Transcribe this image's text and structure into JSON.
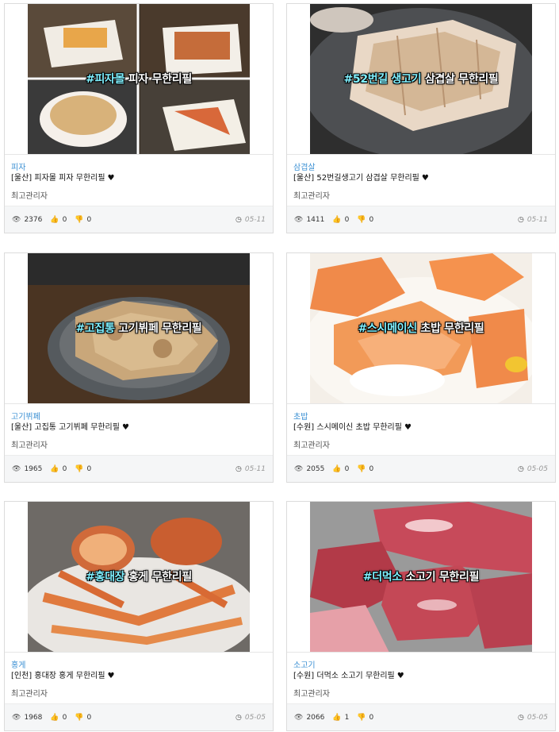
{
  "cards": [
    {
      "category": "피자",
      "title": "[울산] 피자몰 피자 무한리필",
      "author": "최고관리자",
      "views": "2376",
      "likes": "0",
      "dislikes": "0",
      "date": "05-11",
      "caption_tag": "#피자몰",
      "caption_text": " 피자 무한리필"
    },
    {
      "category": "삼겹살",
      "title": "[울산] 52번길생고기 삼겹살 무한리필",
      "author": "최고관리자",
      "views": "1411",
      "likes": "0",
      "dislikes": "0",
      "date": "05-11",
      "caption_tag": "#52번길 생고기",
      "caption_text": " 삼겹살 무한리필"
    },
    {
      "category": "고기뷔페",
      "title": "[울산] 고집통 고기뷔페 무한리필",
      "author": "최고관리자",
      "views": "1965",
      "likes": "0",
      "dislikes": "0",
      "date": "05-11",
      "caption_tag": "#고집통",
      "caption_text": " 고기뷔페 무한리필"
    },
    {
      "category": "초밥",
      "title": "[수원] 스시메이신 초밥 무한리필",
      "author": "최고관리자",
      "views": "2055",
      "likes": "0",
      "dislikes": "0",
      "date": "05-05",
      "caption_tag": "#스시메이신",
      "caption_text": " 초밥 무한리필"
    },
    {
      "category": "홍게",
      "title": "[인천] 홍대장 홍게 무한리필",
      "author": "최고관리자",
      "views": "1968",
      "likes": "0",
      "dislikes": "0",
      "date": "05-05",
      "caption_tag": "#홍대장",
      "caption_text": " 홍게 무한리필"
    },
    {
      "category": "소고기",
      "title": "[수원] 더먹소 소고기 무한리필",
      "author": "최고관리자",
      "views": "2066",
      "likes": "1",
      "dislikes": "0",
      "date": "05-05",
      "caption_tag": "#더먹소",
      "caption_text": " 소고기 무한리필"
    }
  ],
  "icons": {
    "heart": "heart-icon",
    "views": "eye-icon",
    "likes": "thumbs-up-icon",
    "dislikes": "thumbs-down-icon",
    "date": "clock-icon"
  },
  "colors": {
    "category": "#3a8fd3",
    "caption_tag": "#7ff0ff",
    "meta_bg": "#f5f6f7"
  }
}
